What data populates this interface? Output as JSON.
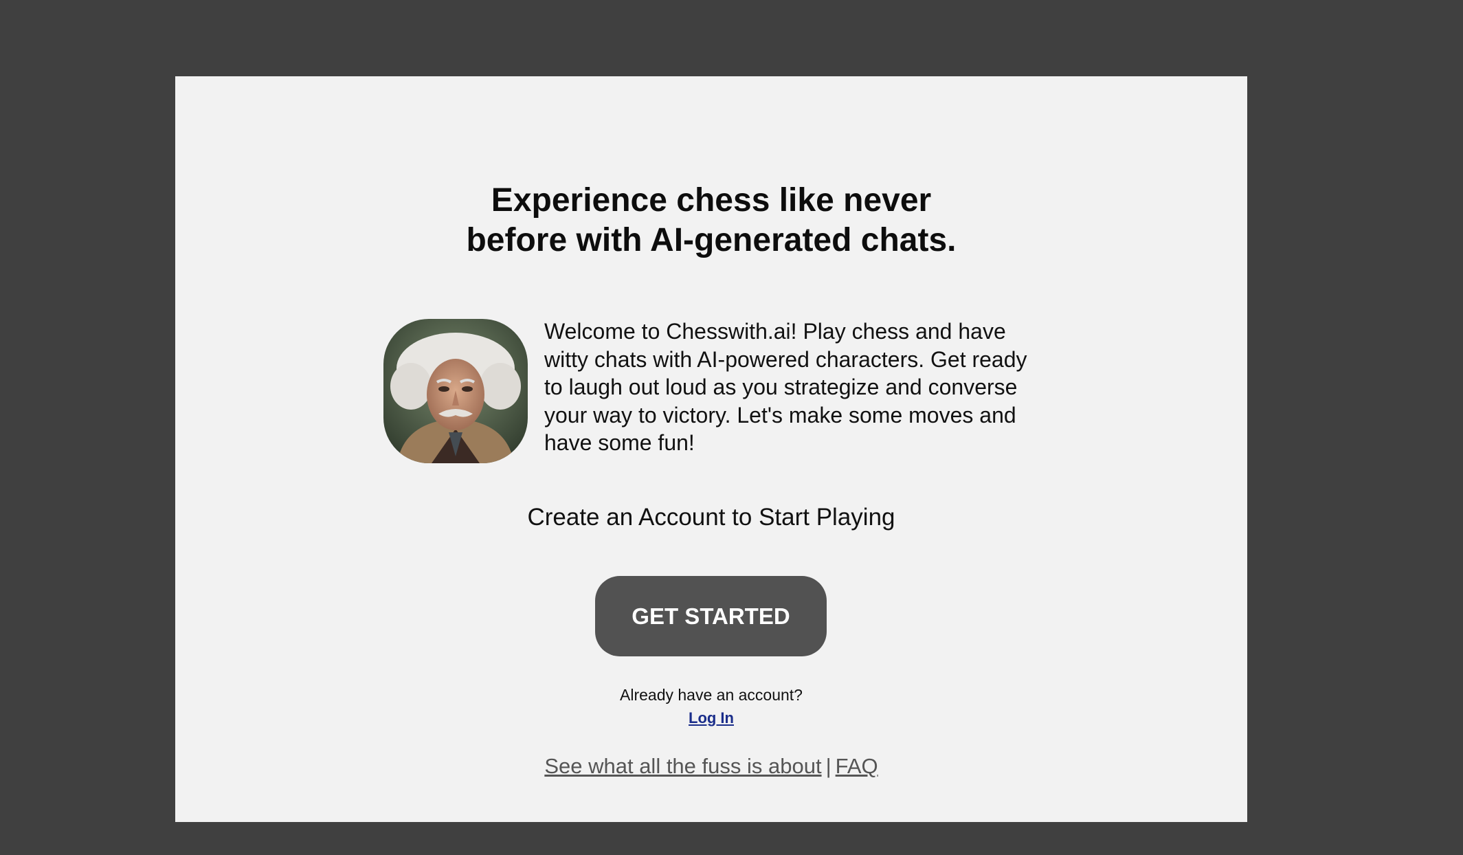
{
  "hero": {
    "headline_line1": "Experience chess like never",
    "headline_line2": "before with AI-generated chats."
  },
  "intro": {
    "avatar_icon": "elderly-scientist-portrait",
    "text": "Welcome to Chesswith.ai! Play chess and have witty chats with AI-powered characters. Get ready to laugh out loud as you strategize and converse your way to victory. Let's make some moves and have some fun!"
  },
  "cta": {
    "prompt": "Create an Account to Start Playing",
    "button_label": "GET STARTED"
  },
  "login": {
    "prompt": "Already have an account?",
    "link_label": "Log In"
  },
  "footer": {
    "about_link": "See what all the fuss is about",
    "separator": "|",
    "faq_link": "FAQ"
  },
  "colors": {
    "page_background": "#404040",
    "panel_background": "#f2f2f2",
    "button_background": "#525252",
    "login_link": "#1a2d8a"
  }
}
